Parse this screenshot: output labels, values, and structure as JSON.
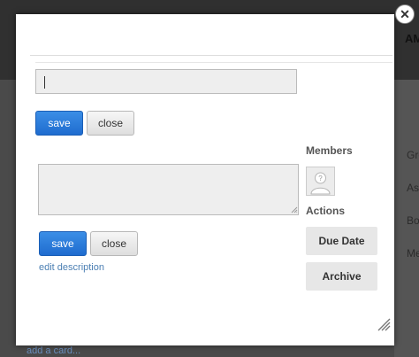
{
  "background": {
    "top_text": "AM",
    "side_labels": [
      "Gro",
      "Ass",
      "Boa",
      "Me"
    ],
    "add_card": "add a card..."
  },
  "modal": {
    "close_icon": "close-icon",
    "title_input_value": "",
    "title_save_label": "save",
    "title_close_label": "close",
    "description_value": "",
    "desc_save_label": "save",
    "desc_close_label": "close",
    "edit_description_link": "edit description",
    "members_heading": "Members",
    "actions_heading": "Actions",
    "due_date_label": "Due Date",
    "archive_label": "Archive"
  },
  "colors": {
    "primary_button": "#1f6ccf",
    "link": "#4b7fb3",
    "overlay": "#3f3f3f"
  }
}
